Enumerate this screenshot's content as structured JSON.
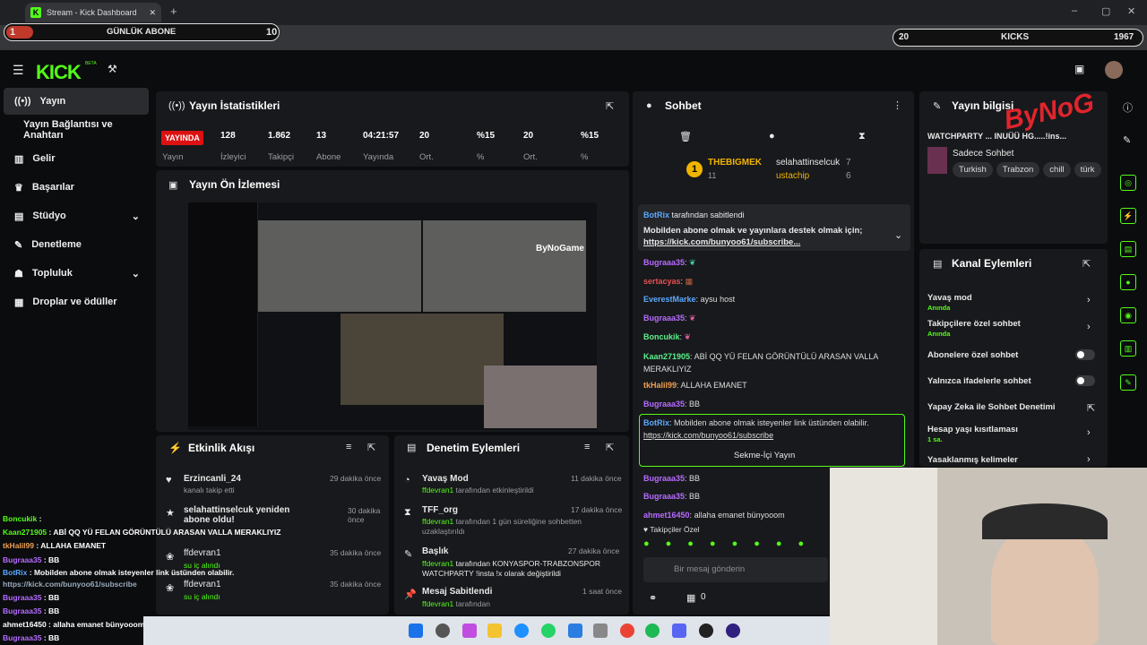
{
  "browser": {
    "tab_title": "Stream - Kick Dashboard",
    "url": "dashboard.kick.com/stream"
  },
  "overlay_top": {
    "count_left": "1",
    "label": "GÜNLÜK ABONE",
    "count_right": "10",
    "stat_left": "20",
    "kicks": "KICKS",
    "stat_right": "1967"
  },
  "nav": {
    "logo": "KICK",
    "beta": "BETA"
  },
  "sidebar": {
    "items": [
      {
        "label": "Yayın"
      },
      {
        "label": "Yayın Bağlantısı ve Anahtarı"
      },
      {
        "label": "Gelir"
      },
      {
        "label": "Başarılar"
      },
      {
        "label": "Stüdyo"
      },
      {
        "label": "Denetleme"
      },
      {
        "label": "Topluluk"
      },
      {
        "label": "Droplar ve ödüller"
      }
    ]
  },
  "stats": {
    "title": "Yayın İstatistikleri",
    "live_badge": "YAYINDA",
    "values": [
      "128",
      "1.862",
      "13",
      "04:21:57",
      "20",
      "%15",
      "20",
      "%15"
    ],
    "labels": [
      "Yayın",
      "İzleyici",
      "Takipçi",
      "Abone",
      "Yayında",
      "Ort.",
      "%",
      "Ort.",
      "%"
    ]
  },
  "preview": {
    "title": "Yayın Ön İzlemesi",
    "watermark": "ByNoGame"
  },
  "activity": {
    "title": "Etkinlik Akışı",
    "items": [
      {
        "name": "Erzincanli_24",
        "desc": "kanalı takip etti",
        "time": "29 dakika önce"
      },
      {
        "name": "selahattinselcuk yeniden abone oldu!",
        "desc": "",
        "time": "30 dakika önce"
      },
      {
        "name": "ffdevran1",
        "desc": "su iç alındı",
        "time": "35 dakika önce"
      },
      {
        "name": "ffdevran1",
        "desc": "su iç alındı",
        "time": "35 dakika önce"
      }
    ]
  },
  "moderation": {
    "title": "Denetim Eylemleri",
    "items": [
      {
        "title": "Yavaş Mod",
        "user": "ffdevran1",
        "desc": "tarafından etkinleştirildi",
        "time": "11 dakika önce"
      },
      {
        "title": "TFF_org",
        "user": "ffdevran1",
        "desc": "tarafından 1 gün süreliğine sohbetten uzaklaştırıldı",
        "time": "17 dakika önce"
      },
      {
        "title": "Başlık",
        "user": "ffdevran1",
        "desc": "tarafından KONYASPOR-TRABZONSPOR WATCHPARTY !insta !x olarak değiştirildi",
        "time": "27 dakika önce"
      },
      {
        "title": "Mesaj Sabitlendi",
        "user": "ffdevran1",
        "desc": "tarafından",
        "time": "1 saat önce"
      }
    ]
  },
  "chat": {
    "title": "Sohbet",
    "top_user": "THEBIGMEK",
    "top_user_count": "11",
    "rank": "1",
    "gifter1": "selahattinselcuk",
    "gifter1_count": "7",
    "gifter2": "ustachip",
    "gifter2_count": "6",
    "pinned_by": "BotRix",
    "pinned_by_suffix": "tarafından sabitlendi",
    "pinned_text": "Mobilden abone olmak ve yayınlara destek olmak için;",
    "pinned_link": "https://kick.com/bunyoo61/subscribe...",
    "messages": [
      {
        "user": "Bugraaa35",
        "text": ""
      },
      {
        "user": "sertacyas",
        "text": ""
      },
      {
        "user": "EverestMarke",
        "text": "aysu host"
      },
      {
        "user": "Bugraaa35",
        "text": ""
      },
      {
        "user": "Boncukik",
        "text": ""
      },
      {
        "user": "Kaan271905",
        "text": "ABİ QQ YÜ FELAN GÖRÜNTÜLÜ ARASAN VALLA MERAKLIYIZ"
      },
      {
        "user": "tkHalil99",
        "text": "ALLAHA EMANET"
      },
      {
        "user": "Bugraaa35",
        "text": "BB"
      }
    ],
    "bot_user": "BotRix",
    "bot_text": "Mobilden abone olmak isteyenler link üstünden olabilir.",
    "bot_link": "https://kick.com/bunyoo61/subscribe",
    "inline_btn": "Sekme-İçi Yayın",
    "after": [
      {
        "user": "Bugraaa35",
        "text": "BB"
      },
      {
        "user": "Bugraaa35",
        "text": "BB"
      },
      {
        "user": "ahmet16450",
        "text": "allaha emanet bünyooom"
      }
    ],
    "followers_only": "Takipçiler Özel",
    "input_placeholder": "Bir mesaj gönderin",
    "count": "0"
  },
  "stream_info": {
    "title": "Yayın bilgisi",
    "stream_title": "WATCHPARTY ... INUÜÜ HG.....!ins...",
    "category": "Sadece Sohbet",
    "tags": [
      "Turkish",
      "Trabzon",
      "chill",
      "türk"
    ],
    "logo_text": "ByNoG"
  },
  "channel_actions": {
    "title": "Kanal Eylemleri",
    "items": [
      {
        "label": "Yavaş mod",
        "sub": "Anında"
      },
      {
        "label": "Takipçilere özel sohbet",
        "sub": "Anında"
      },
      {
        "label": "Abonelere özel sohbet",
        "sub": ""
      },
      {
        "label": "Yalnızca ifadelerle sohbet",
        "sub": ""
      },
      {
        "label": "Yapay Zeka ile Sohbet Denetimi",
        "sub": ""
      },
      {
        "label": "Hesap yaşı kısıtlaması",
        "sub": "1 sa."
      },
      {
        "label": "Yasaklanmış kelimeler",
        "sub": ""
      }
    ]
  },
  "stream_overlay_chat": [
    {
      "user": "Boncukik",
      "text": ""
    },
    {
      "user": "Kaan271905",
      "text": "ABİ QQ YÜ FELAN GÖRÜNTÜLÜ ARASAN VALLA MERAKLIYIZ"
    },
    {
      "user": "tkHalil99",
      "text": "ALLAHA EMANET"
    },
    {
      "user": "Bugraaa35",
      "text": "BB"
    },
    {
      "user": "BotRix",
      "text": "Mobilden abone olmak isteyenler link üstünden olabilir."
    },
    {
      "user": "",
      "text": "https://kick.com/bunyoo61/subscribe"
    },
    {
      "user": "Bugraaa35",
      "text": "BB"
    },
    {
      "user": "Bugraaa35",
      "text": "BB"
    },
    {
      "user": "ahmet16450",
      "text": "allaha emanet bünyooom"
    },
    {
      "user": "Bugraaa35",
      "text": "BB"
    }
  ]
}
